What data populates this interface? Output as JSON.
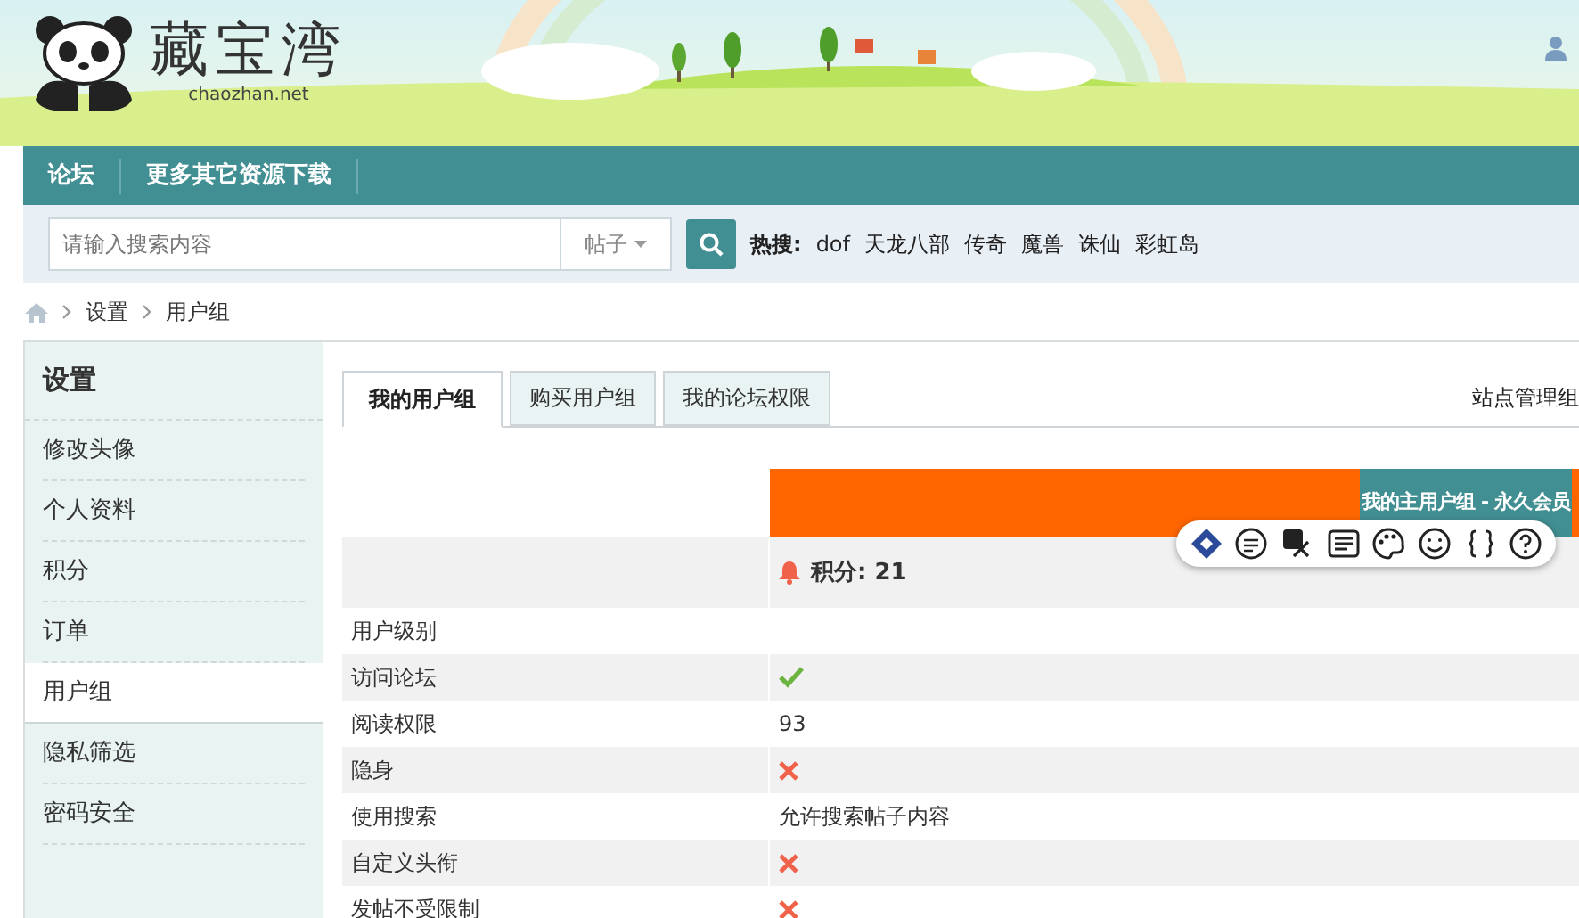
{
  "header": {
    "logo_text": "藏宝湾",
    "logo_domain": "chaozhan.net"
  },
  "nav": {
    "items": [
      {
        "label": "论坛"
      },
      {
        "label": "更多其它资源下载"
      }
    ]
  },
  "search": {
    "placeholder": "请输入搜索内容",
    "scope": "帖子",
    "hot_label": "热搜:",
    "hot_terms": [
      "dof",
      "天龙八部",
      "传奇",
      "魔兽",
      "诛仙",
      "彩虹岛"
    ]
  },
  "breadcrumb": [
    "设置",
    "用户组"
  ],
  "sidebar": {
    "title": "设置",
    "items": [
      {
        "label": "修改头像",
        "selected": false
      },
      {
        "label": "个人资料",
        "selected": false
      },
      {
        "label": "积分",
        "selected": false
      },
      {
        "label": "订单",
        "selected": false
      },
      {
        "label": "用户组",
        "selected": true
      },
      {
        "label": "隐私筛选",
        "selected": false
      },
      {
        "label": "密码安全",
        "selected": false
      }
    ]
  },
  "tabs": [
    {
      "label": "我的用户组",
      "selected": true
    },
    {
      "label": "购买用户组",
      "selected": false
    },
    {
      "label": "我的论坛权限",
      "selected": false
    }
  ],
  "admin_link": "站点管理组",
  "table": {
    "group_header": "我的主用户组 - 永久会员",
    "points": "积分: 21",
    "rows": [
      {
        "label": "用户级别",
        "kind": "blank"
      },
      {
        "label": "访问论坛",
        "kind": "flag",
        "allowed": true
      },
      {
        "label": "阅读权限",
        "kind": "text",
        "value": "93"
      },
      {
        "label": "隐身",
        "kind": "flag",
        "allowed": false
      },
      {
        "label": "使用搜索",
        "kind": "text",
        "value": "允许搜索帖子内容"
      },
      {
        "label": "自定义头衔",
        "kind": "flag",
        "allowed": false
      },
      {
        "label": "发帖不受限制",
        "kind": "flag",
        "allowed": false
      }
    ]
  }
}
